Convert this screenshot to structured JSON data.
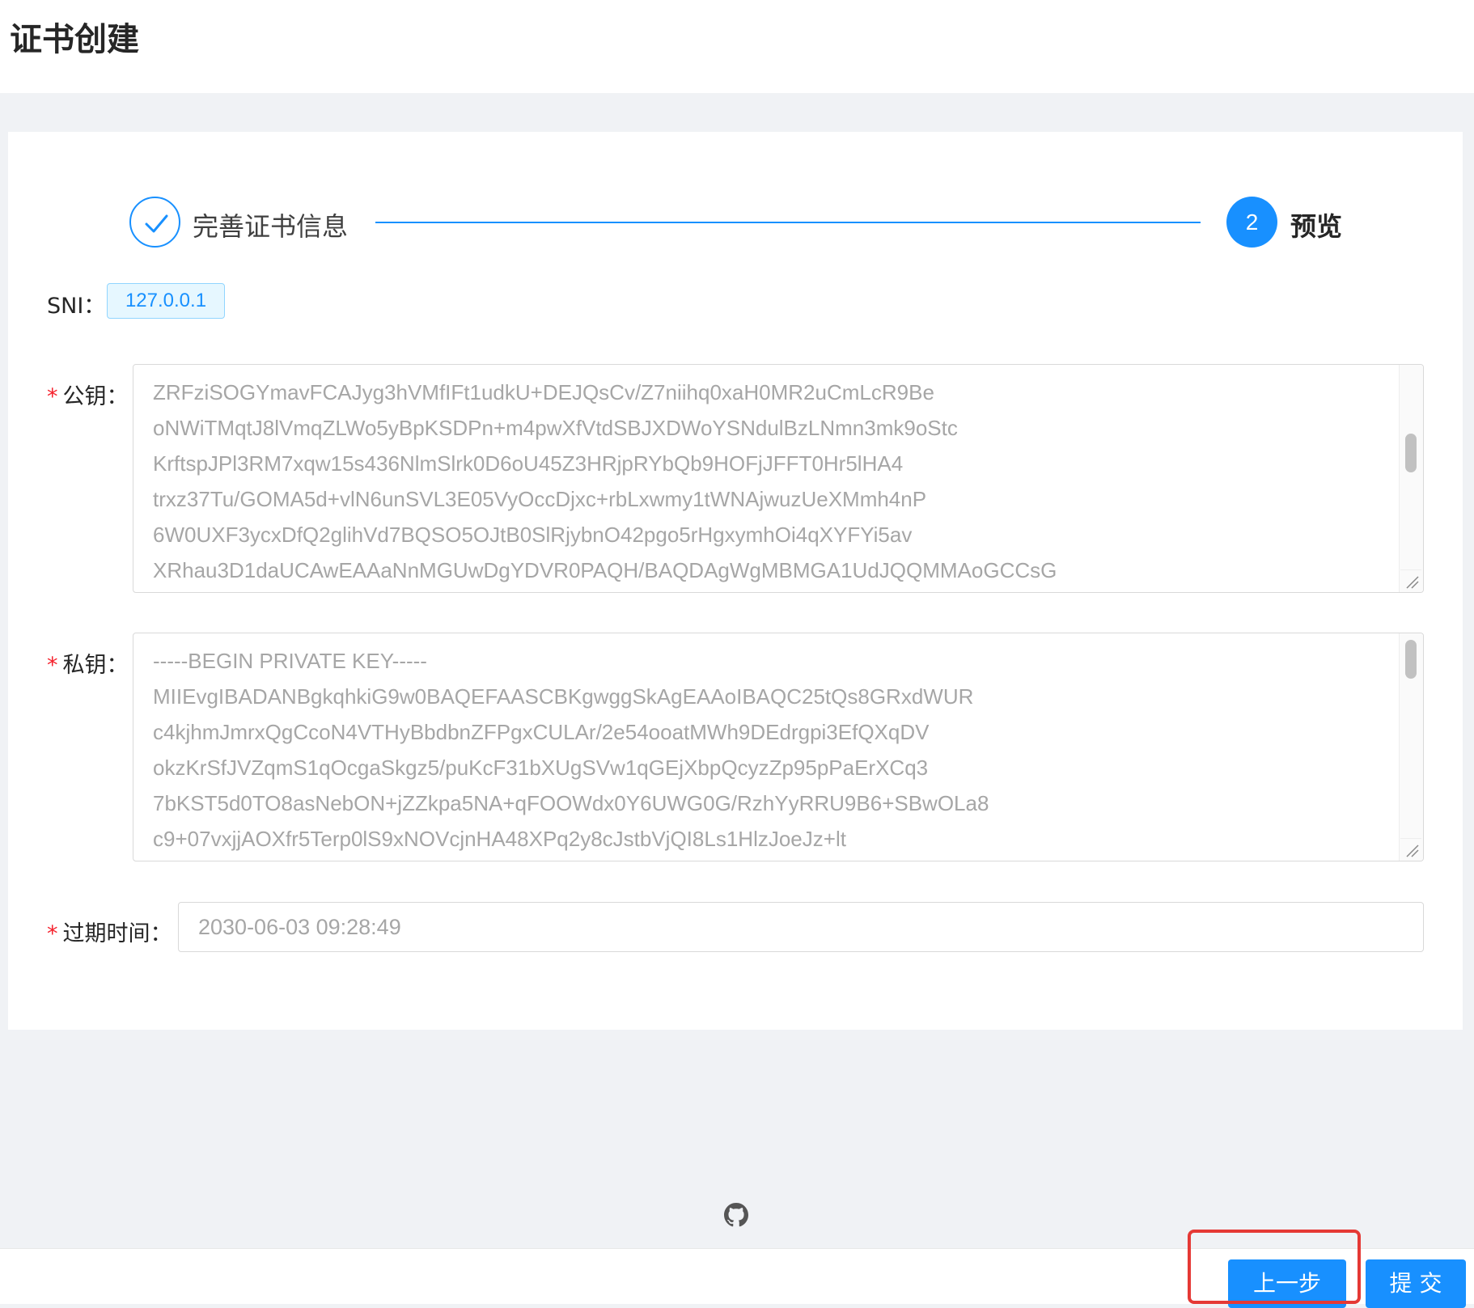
{
  "header": {
    "title": "证书创建"
  },
  "steps": {
    "step1": {
      "title": "完善证书信息",
      "status": "finished"
    },
    "step2": {
      "number": "2",
      "title": "预览",
      "status": "active"
    }
  },
  "form": {
    "sni": {
      "label": "SNI：",
      "value": "127.0.0.1"
    },
    "public_key": {
      "label": "公钥：",
      "lines": [
        "ZRFziSOGYmavFCAJyg3hVMfIFt1udkU+DEJQsCv/Z7niihq0xaH0MR2uCmLcR9Be",
        "oNWiTMqtJ8lVmqZLWo5yBpKSDPn+m4pwXfVtdSBJXDWoYSNdulBzLNmn3mk9oStc",
        "KrftspJPl3RM7xqw15s436NlmSlrk0D6oU45Z3HRjpRYbQb9HOFjJFFT0Hr5lHA4",
        "trxz37Tu/GOMA5d+vlN6unSVL3E05VyOccDjxc+rbLxwmy1tWNAjwuzUeXMmh4nP",
        "6W0UXF3ycxDfQ2glihVd7BQSO5OJtB0SlRjybnO42pgo5rHgxymhOi4qXYFYi5av",
        "XRhau3D1daUCAwEAAaNnMGUwDgYDVR0PAQH/BAQDAgWgMBMGA1UdJQQMMAoGCCsG"
      ]
    },
    "private_key": {
      "label": "私钥：",
      "lines": [
        "-----BEGIN PRIVATE KEY-----",
        "MIIEvgIBADANBgkqhkiG9w0BAQEFAASCBKgwggSkAgEAAoIBAQC25tQs8GRxdWUR",
        "c4kjhmJmrxQgCcoN4VTHyBbdbnZFPgxCULAr/2e54ooatMWh9DEdrgpi3EfQXqDV",
        "okzKrSfJVZqmS1qOcgaSkgz5/puKcF31bXUgSVw1qGEjXbpQcyzZp95pPaErXCq3",
        "7bKST5d0TO8asNebON+jZZkpa5NA+qFOOWdx0Y6UWG0G/RzhYyRRU9B6+SBwOLa8",
        "c9+07vxjjAOXfr5Terp0lS9xNOVcjnHA48XPq2y8cJstbVjQI8Ls1HlzJoeJz+lt"
      ]
    },
    "expire": {
      "label": "过期时间：",
      "value": "2030-06-03 09:28:49"
    }
  },
  "buttons": {
    "prev": "上一步",
    "submit": "提 交"
  },
  "colors": {
    "primary": "#1890ff",
    "required": "#f5222d",
    "highlight": "#e53935"
  },
  "icons": {
    "step_done": "check-icon",
    "footer": "github-icon"
  }
}
